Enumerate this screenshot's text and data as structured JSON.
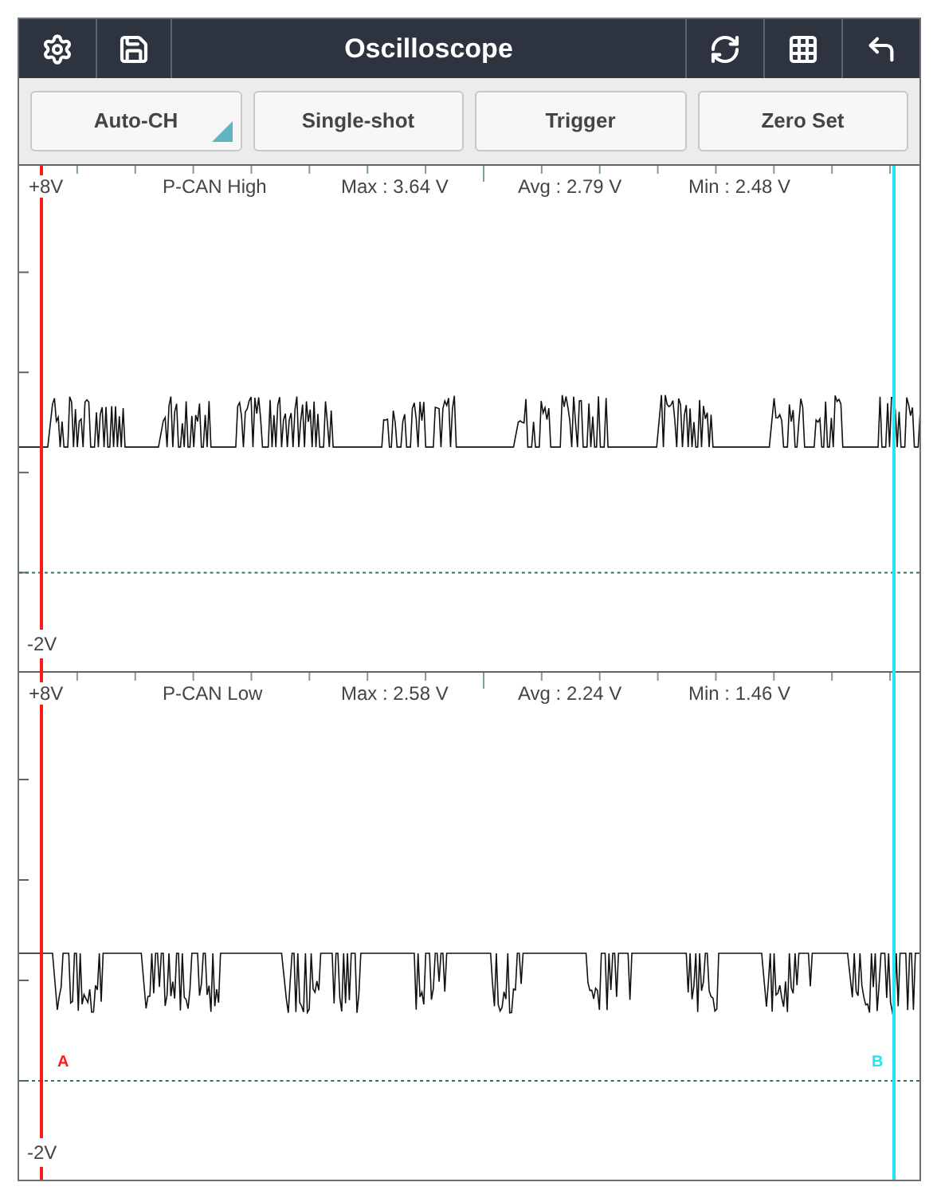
{
  "header": {
    "title": "Oscilloscope"
  },
  "buttons": [
    {
      "label": "Auto-CH",
      "kind": "dropdown"
    },
    {
      "label": "Single-shot",
      "kind": "plain"
    },
    {
      "label": "Trigger",
      "kind": "plain"
    },
    {
      "label": "Zero Set",
      "kind": "plain"
    }
  ],
  "channels": [
    {
      "kind": "high",
      "top_label": "+8V",
      "name": "P-CAN High",
      "max": "Max : 3.64 V",
      "avg": "Avg : 2.79 V",
      "min": "Min : 2.48 V",
      "bottom_label": "-2V"
    },
    {
      "kind": "low",
      "top_label": "+8V",
      "name": "P-CAN Low",
      "max": "Max : 2.58 V",
      "avg": "Avg : 2.24 V",
      "min": "Min : 1.46 V",
      "bottom_label": "-2V"
    }
  ],
  "cursors": [
    {
      "label": "A",
      "color": "#ff1a1a"
    },
    {
      "label": "B",
      "color": "#22e5ef"
    }
  ]
}
